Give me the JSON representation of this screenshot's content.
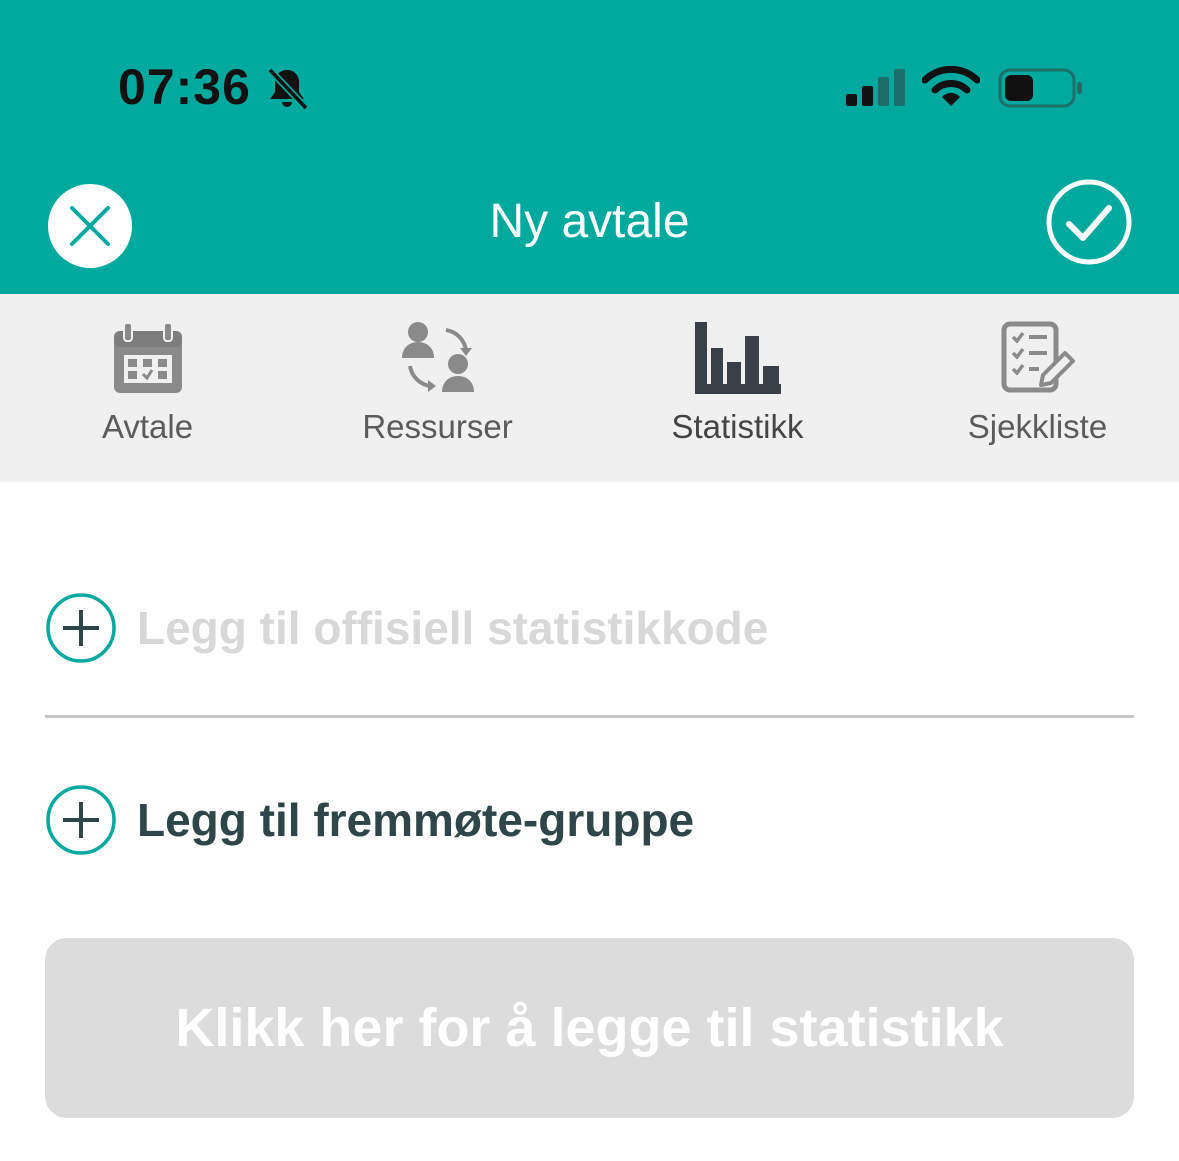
{
  "status_bar": {
    "time": "07:36",
    "icons": [
      "bell-slash-icon",
      "cellular-signal-icon",
      "wifi-icon",
      "battery-icon"
    ]
  },
  "header": {
    "title": "Ny avtale",
    "close_icon": "close-icon",
    "confirm_icon": "checkmark-circle-icon",
    "color": "#00a99d"
  },
  "tabs": [
    {
      "label": "Avtale",
      "icon": "calendar-icon"
    },
    {
      "label": "Ressurser",
      "icon": "people-exchange-icon"
    },
    {
      "label": "Statistikk",
      "icon": "bar-chart-icon",
      "active": true
    },
    {
      "label": "Sjekkliste",
      "icon": "checklist-icon"
    }
  ],
  "main": {
    "add_stat_code": "Legg til offisiell statistikkode",
    "add_attendance_group": "Legg til fremmøte-gruppe",
    "add_stat_button": "Klikk her for å legge til statistikk"
  },
  "colors": {
    "accent": "#00a99d",
    "tab_bg": "#f0f0f0",
    "button_disabled": "#dcdcdc",
    "text_dark": "#2e4549"
  }
}
